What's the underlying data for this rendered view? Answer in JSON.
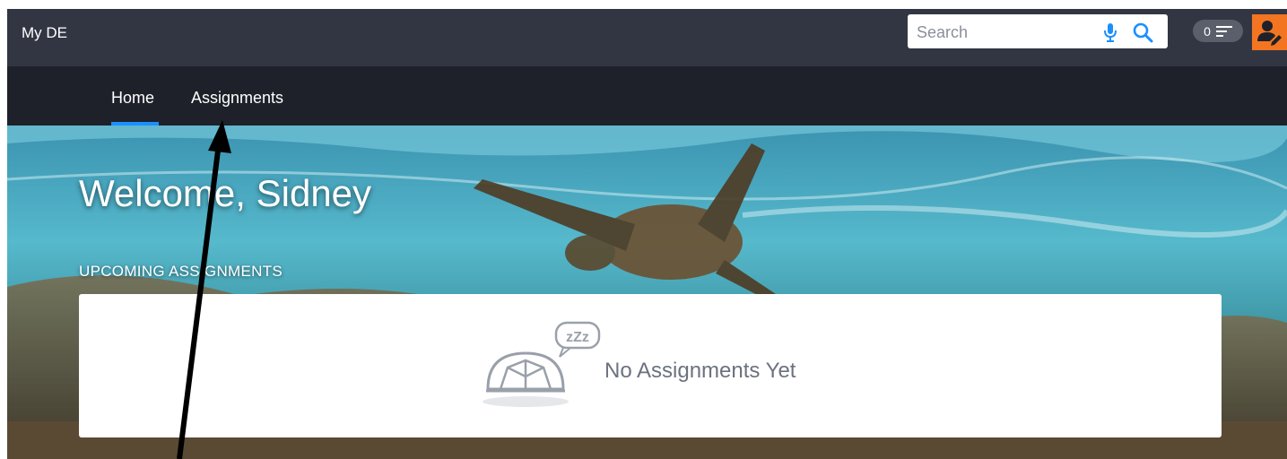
{
  "topbar": {
    "brand": "My DE",
    "search": {
      "placeholder": "Search",
      "value": ""
    },
    "notifications": {
      "count": "0"
    }
  },
  "nav": {
    "tabs": [
      {
        "label": "Home",
        "active": true
      },
      {
        "label": "Assignments",
        "active": false
      }
    ]
  },
  "hero": {
    "welcome": "Welcome, Sidney",
    "section_label": "UPCOMING ASSIGNMENTS"
  },
  "assignments_card": {
    "empty_text": "No Assignments Yet",
    "bubble_text": "zZz"
  },
  "colors": {
    "topbar_bg": "#323643",
    "nav_bg": "#1e2129",
    "active_underline": "#1b8fff",
    "profile_accent": "#f47521"
  },
  "icons": [
    "mic-icon",
    "search-icon",
    "list-icon",
    "user-edit-icon",
    "turtle-icon"
  ]
}
